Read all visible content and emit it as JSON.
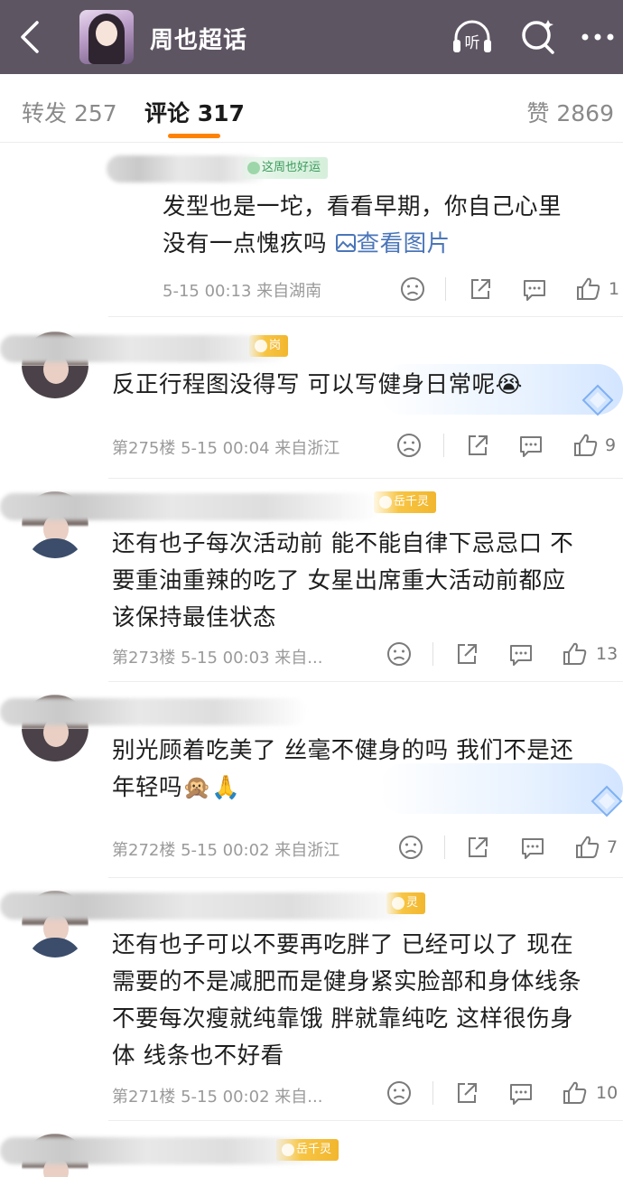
{
  "topbar": {
    "title": "周也超话",
    "listen_label": "听"
  },
  "tabs": {
    "forward": "转发 257",
    "comment": "评论 317",
    "like": "赞 2869"
  },
  "comments": [
    {
      "badge": "这周也好运",
      "text": [
        "发型也是一坨，看看早期，你自己心里",
        "没有一点愧疚吗"
      ],
      "link": "查看图片",
      "meta": "5-15 00:13  来自湖南",
      "likes": "1"
    },
    {
      "badge": "岗",
      "text": [
        "反正行程图没得写 可以写健身日常呢😭"
      ],
      "meta": "第275楼 5-15 00:04  来自浙江",
      "likes": "9"
    },
    {
      "badge": "岳千灵",
      "text": [
        "还有也子每次活动前 能不能自律下忌忌口 不",
        "要重油重辣的吃了 女星出席重大活动前都应",
        "该保持最佳状态"
      ],
      "meta": "第273楼 5-15 00:03  来自...",
      "likes": "13"
    },
    {
      "badge": "",
      "text": [
        "别光顾着吃美了 丝毫不健身的吗 我们不是还",
        "年轻吗🙊🙏"
      ],
      "meta": "第272楼 5-15 00:02  来自浙江",
      "likes": "7"
    },
    {
      "badge": "灵",
      "text": [
        "还有也子可以不要再吃胖了 已经可以了 现在",
        "需要的不是减肥而是健身紧实脸部和身体线条",
        "不要每次瘦就纯靠饿 胖就靠纯吃 这样很伤身",
        "体 线条也不好看"
      ],
      "meta": "第271楼 5-15 00:02  来自...",
      "likes": "10"
    },
    {
      "badge": "岳千灵"
    }
  ],
  "colors": {
    "topbar_bg": "#5e5563",
    "accent": "#ff8200",
    "link": "#4a76b8",
    "text": "#1e1e1e",
    "meta": "#9a9a9a"
  },
  "icons": [
    "back-arrow-icon",
    "headphones-icon",
    "search-icon",
    "more-icon",
    "frown-icon",
    "share-icon",
    "comment-icon",
    "thumbs-up-icon",
    "image-icon",
    "diamond-icon"
  ]
}
